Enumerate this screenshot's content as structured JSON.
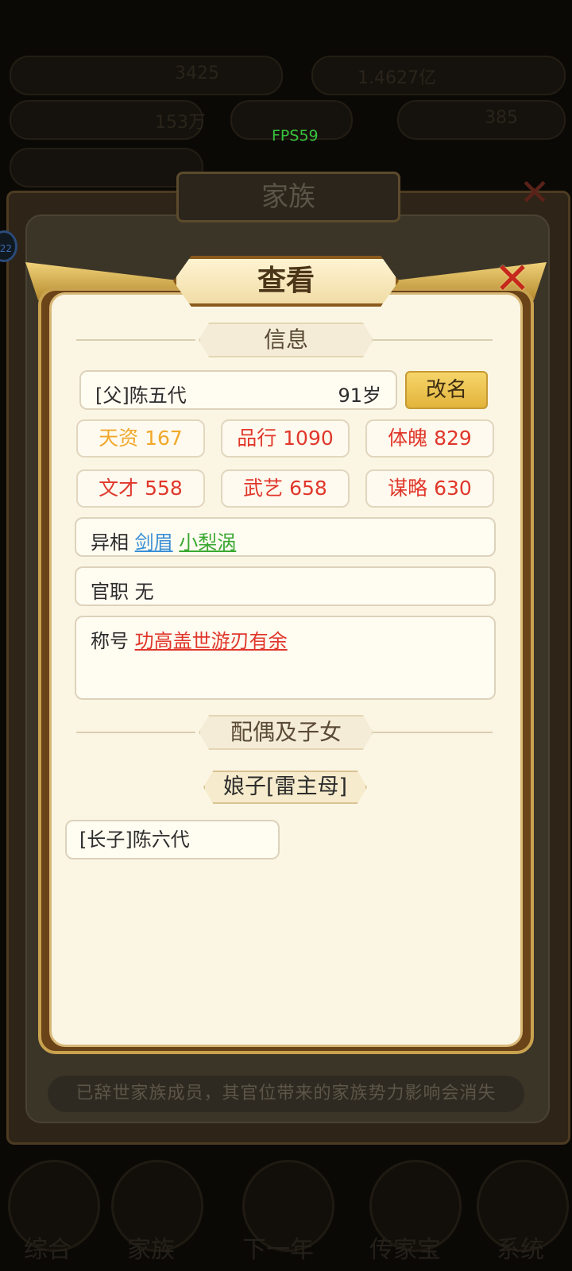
{
  "fps": "FPS59",
  "background": {
    "top_left_value": "3425",
    "top_right_value": "1.4627亿",
    "second_left_value": "153万",
    "second_right_value": "385",
    "family_title": "家族",
    "notice": "已辞世家族成员，其官位带来的家族势力影响会消失",
    "side_badge": "22",
    "nav": [
      "综合",
      "家族",
      "下一年",
      "传家宝",
      "系统"
    ]
  },
  "dialog": {
    "title": "查看",
    "info_section": "信息",
    "name": "[父]陈五代",
    "age": "91岁",
    "rename_button": "改名",
    "stats": [
      {
        "label": "天资 167",
        "color": "#f0a82a"
      },
      {
        "label": "品行 1090",
        "color": "#e0372b"
      },
      {
        "label": "体魄 829",
        "color": "#e0372b"
      },
      {
        "label": "文才 558",
        "color": "#e0372b"
      },
      {
        "label": "武艺 658",
        "color": "#e0372b"
      },
      {
        "label": "谋略 630",
        "color": "#e0372b"
      }
    ],
    "traits_label": "异相",
    "traits": [
      {
        "text": "剑眉",
        "color": "#3a8fd6"
      },
      {
        "text": "小梨涡",
        "color": "#3aa832"
      }
    ],
    "office_label": "官职",
    "office_value": "无",
    "honor_label": "称号",
    "honor_value": "功高盖世游刃有余",
    "honor_color": "#e0372b",
    "family_section": "配偶及子女",
    "spouse": "娘子[雷主母]",
    "children": [
      "[长子]陈六代"
    ]
  }
}
